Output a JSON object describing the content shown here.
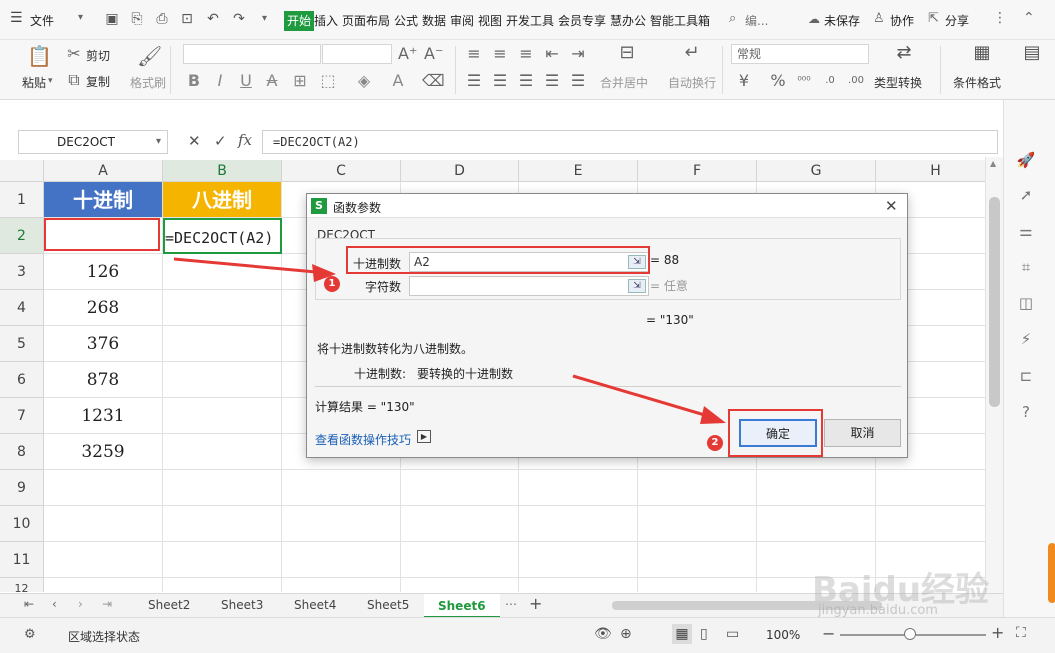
{
  "menubar": {
    "file_label": "文件",
    "tabs": [
      "开始",
      "插入",
      "页面布局",
      "公式",
      "数据",
      "审阅",
      "视图",
      "开发工具",
      "会员专享",
      "慧办公",
      "智能工具箱"
    ],
    "search_label": "编...",
    "unsaved_label": "未保存",
    "collab_label": "协作",
    "share_label": "分享"
  },
  "ribbon": {
    "paste": "粘贴",
    "cut": "剪切",
    "copy": "复制",
    "format_painter": "格式刷",
    "merge_center": "合并居中",
    "wrap_text": "自动换行",
    "number_format": "常规",
    "type_convert": "类型转换",
    "cond_format": "条件格式"
  },
  "formula_bar": {
    "name_box": "DEC2OCT",
    "formula": "=DEC2OCT(A2)",
    "fx": "fx"
  },
  "grid": {
    "columns": [
      "A",
      "B",
      "C",
      "D",
      "E",
      "F",
      "G",
      "H"
    ],
    "rows": [
      "1",
      "2",
      "3",
      "4",
      "5",
      "6",
      "7",
      "8",
      "9",
      "10",
      "11",
      "12"
    ],
    "header_a": "十进制",
    "header_b": "八进制",
    "header_a_color": "#4472c4",
    "header_b_color": "#f5b400",
    "b2_formula": "=DEC2OCT(A2)",
    "a_values": [
      "126",
      "268",
      "376",
      "878",
      "1231",
      "3259"
    ]
  },
  "dialog": {
    "title": "函数参数",
    "function_name": "DEC2OCT",
    "arg1_label": "十进制数",
    "arg1_value": "A2",
    "arg1_result": "= 88",
    "arg2_label": "字符数",
    "arg2_value": "",
    "arg2_result": "= 任意",
    "result_preview": "= \"130\"",
    "description": "将十进制数转化为八进制数。",
    "param_name": "十进制数:",
    "param_desc": "要转换的十进制数",
    "calc_result": "计算结果 = \"130\"",
    "help_link": "查看函数操作技巧",
    "ok": "确定",
    "cancel": "取消",
    "badge1": "1",
    "badge2": "2"
  },
  "sheets": {
    "tabs": [
      "Sheet2",
      "Sheet3",
      "Sheet4",
      "Sheet5",
      "Sheet6"
    ],
    "active": "Sheet6"
  },
  "status": {
    "mode": "区域选择状态",
    "zoom": "100%"
  },
  "watermark": {
    "brand": "Baidu经验",
    "url": "jingyan.baidu.com"
  },
  "colors": {
    "accent": "#1f9a3f",
    "highlight": "#e53935"
  }
}
